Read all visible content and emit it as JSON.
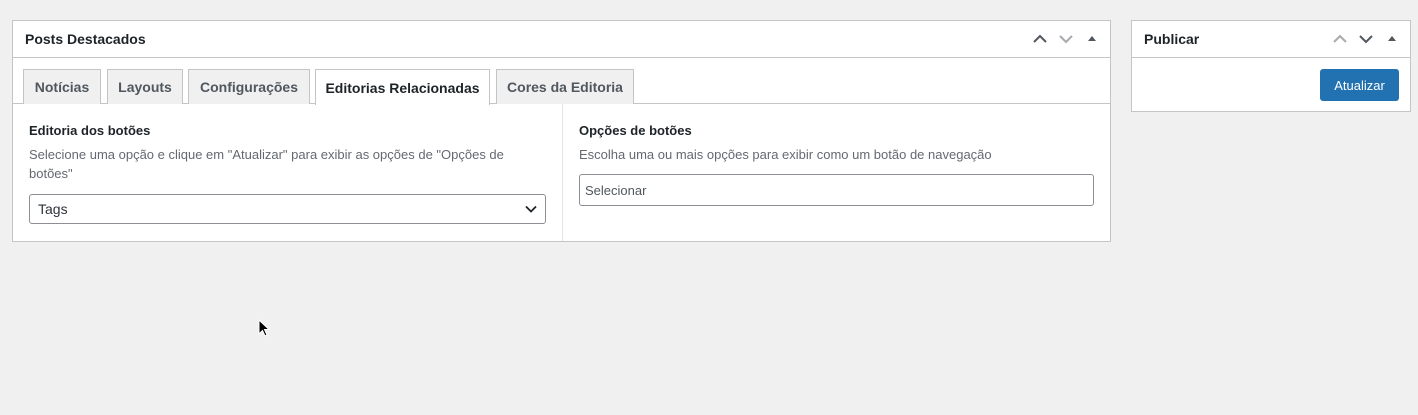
{
  "main_box": {
    "title": "Posts Destacados",
    "tabs": [
      {
        "label": "Notícias",
        "active": false
      },
      {
        "label": "Layouts",
        "active": false
      },
      {
        "label": "Configurações",
        "active": false
      },
      {
        "label": "Editorias Relacionadas",
        "active": true
      },
      {
        "label": "Cores da Editoria",
        "active": false
      }
    ],
    "left_field": {
      "label": "Editoria dos botões",
      "description_line1": "Selecione uma opção e clique em \"Atualizar\" para exibir as opções de \"Opções de",
      "description_line2": "botões\"",
      "select_value": "Tags"
    },
    "right_field": {
      "label": "Opções de botões",
      "description": "Escolha uma ou mais opções para exibir como um botão de navegação",
      "placeholder": "Selecionar"
    }
  },
  "side_box": {
    "title": "Publicar",
    "button_label": "Atualizar"
  },
  "colors": {
    "primary_button": "#2271b1",
    "border": "#c3c4c7",
    "background": "#f0f0f1"
  },
  "icons": [
    "chevron-up-icon",
    "chevron-down-icon",
    "triangle-up-icon",
    "mouse-cursor-icon"
  ]
}
